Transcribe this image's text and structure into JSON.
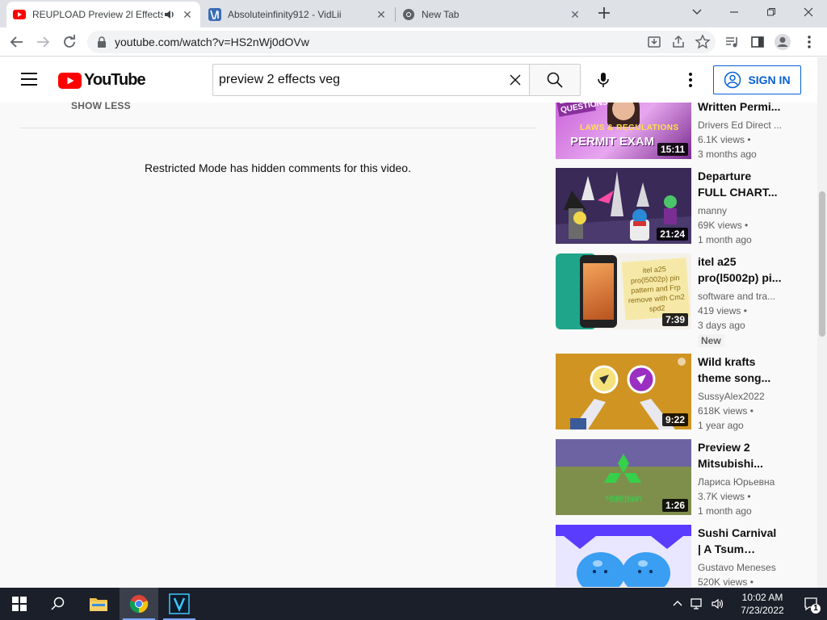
{
  "browser": {
    "tabs": [
      {
        "title": "REUPLOAD Preview 2l Effects",
        "active": true,
        "favicon": "youtube-icon",
        "audio": true
      },
      {
        "title": "Absoluteinfinity912 - VidLii",
        "active": false,
        "favicon": "vidlii-icon"
      },
      {
        "title": "New Tab",
        "active": false,
        "favicon": "chrome-icon"
      }
    ],
    "url": "youtube.com/watch?v=HS2nWj0dOVw"
  },
  "header": {
    "logo_text": "YouTube",
    "search_value": "preview 2 effects veg",
    "signin_label": "SIGN IN"
  },
  "main": {
    "show_less": "SHOW LESS",
    "restricted_message": "Restricted Mode has hidden comments for this video."
  },
  "related": [
    {
      "title": "Written Permi...",
      "channel": "Drivers Ed Direct ...",
      "views": "6.1K views •",
      "age": "3 months ago",
      "duration": "15:11",
      "thumb_text": "PERMIT EXAM",
      "thumb_sub": "LAWS & REGULATIONS",
      "thumb_corner": "EXAM QUESTIONS"
    },
    {
      "title": "Departure FULL CHART...",
      "channel": "manny",
      "views": "69K views •",
      "age": "1 month ago",
      "duration": "21:24"
    },
    {
      "title": "itel a25 pro(l5002p) pi...",
      "channel": "software and tra...",
      "views": "419 views •",
      "age": "3 days ago",
      "badge": "New",
      "duration": "7:39",
      "thumb_text": "itel a25 pro(l5002p) pin pattern and Frp remove with Cm2 spd2"
    },
    {
      "title": "Wild krafts theme song...",
      "channel": "SussyAlex2022",
      "views": "618K views •",
      "age": "1 year ago",
      "duration": "9:22"
    },
    {
      "title": "Preview 2 Mitsubishi...",
      "channel": "Лариса Юрьевна",
      "views": "3.7K views •",
      "age": "1 month ago",
      "duration": "1:26"
    },
    {
      "title": "Sushi Carnival | A Tsum Tsum...",
      "channel": "Gustavo Meneses",
      "views": "520K views •",
      "age": "",
      "duration": ""
    }
  ],
  "taskbar": {
    "time": "10:02 AM",
    "date": "7/23/2022",
    "notification_count": "1"
  },
  "colors": {
    "yt_red": "#ff0000",
    "link_blue": "#065fd4",
    "taskbar_bg": "#1b1f2a"
  }
}
